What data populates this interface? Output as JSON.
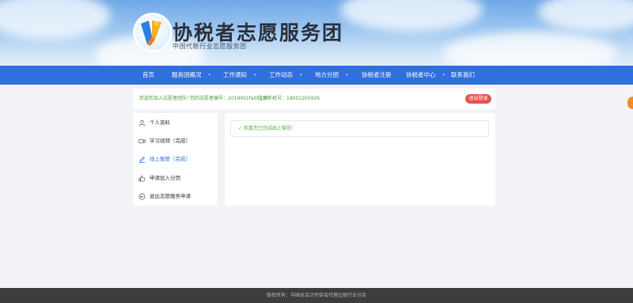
{
  "header": {
    "title": "协税者志愿服务团",
    "subtitle": "中国代账行业志愿服务团"
  },
  "nav": {
    "items": [
      {
        "label": "首页"
      },
      {
        "label": "服务团概况",
        "caret": "▾"
      },
      {
        "label": "工作通知",
        "caret": "▾"
      },
      {
        "label": "工作动态",
        "caret": "▾"
      },
      {
        "label": "地方分团",
        "caret": "▾"
      },
      {
        "label": "协税者注册"
      },
      {
        "label": "协税者中心",
        "caret": "▾"
      },
      {
        "label": "联系我们"
      }
    ]
  },
  "user_bar": {
    "welcome": "欢迎您加入志愿者团队！",
    "volunteer_id": "您的志愿者编号：2019001fa00110",
    "phone": "注册手机号：18001205926",
    "logout_label": "退出登录"
  },
  "sidebar": {
    "items": [
      {
        "label": "个人资料",
        "icon": "user-icon"
      },
      {
        "label": "学习视频（完成）",
        "icon": "video-icon"
      },
      {
        "label": "线上誓愿（完成）",
        "icon": "pen-icon",
        "active": true
      },
      {
        "label": "申请加入分团",
        "icon": "hand-icon"
      },
      {
        "label": "退出志愿服务申请",
        "icon": "exit-icon"
      }
    ]
  },
  "content": {
    "notice": "✓ 恭喜您已完成线上誓愿!"
  },
  "footer": {
    "text": "版权所有：中国总会计师协会代理记账行业分会"
  },
  "colors": {
    "nav_bg": "#2f6fde",
    "accent_green": "#4a9a3f",
    "logout_red": "#e3564d",
    "footer_bg": "#3d3d3d"
  }
}
